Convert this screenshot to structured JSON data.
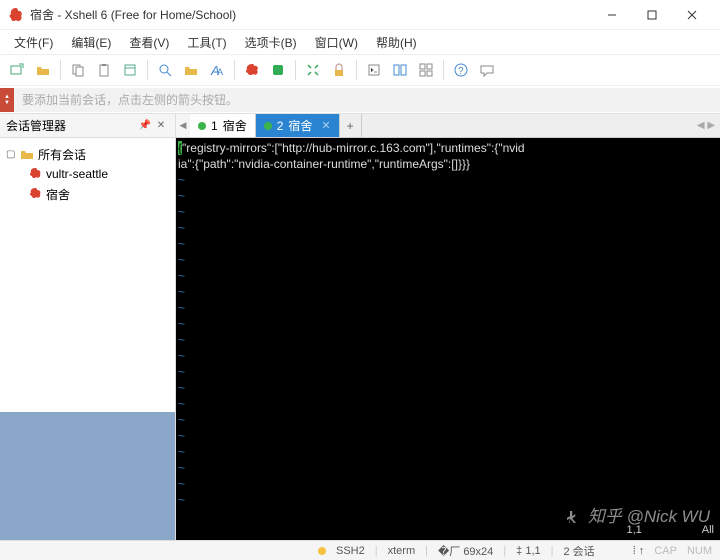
{
  "window": {
    "title": "宿舍 - Xshell 6 (Free for Home/School)"
  },
  "menu": {
    "file": "文件(F)",
    "edit": "编辑(E)",
    "view": "查看(V)",
    "tools": "工具(T)",
    "options": "选项卡(B)",
    "window": "窗口(W)",
    "help": "帮助(H)"
  },
  "addressbar": {
    "placeholder": "要添加当前会话，点击左侧的箭头按钮。"
  },
  "sidebar": {
    "title": "会话管理器",
    "root": "所有会话",
    "items": [
      "vultr-seattle",
      "宿舍"
    ]
  },
  "tabs": {
    "list": [
      {
        "index": "1",
        "label": "宿舍",
        "active": false
      },
      {
        "index": "2",
        "label": "宿舍",
        "active": true
      }
    ]
  },
  "terminal": {
    "line1_lead": "{",
    "line1": "\"registry-mirrors\":[\"http://hub-mirror.c.163.com\"],\"runtimes\":{\"nvid",
    "line2": "ia\":{\"path\":\"nvidia-container-runtime\",\"runtimeArgs\":[]}}}",
    "pos": "1,1",
    "mode": "All"
  },
  "statusbar": {
    "proto": "SSH2",
    "term": "xterm",
    "size": "69x24",
    "cursor": "1,1",
    "sessions": "2 会话",
    "cap": "CAP",
    "num": "NUM"
  },
  "watermark": "知乎 @Nick WU"
}
